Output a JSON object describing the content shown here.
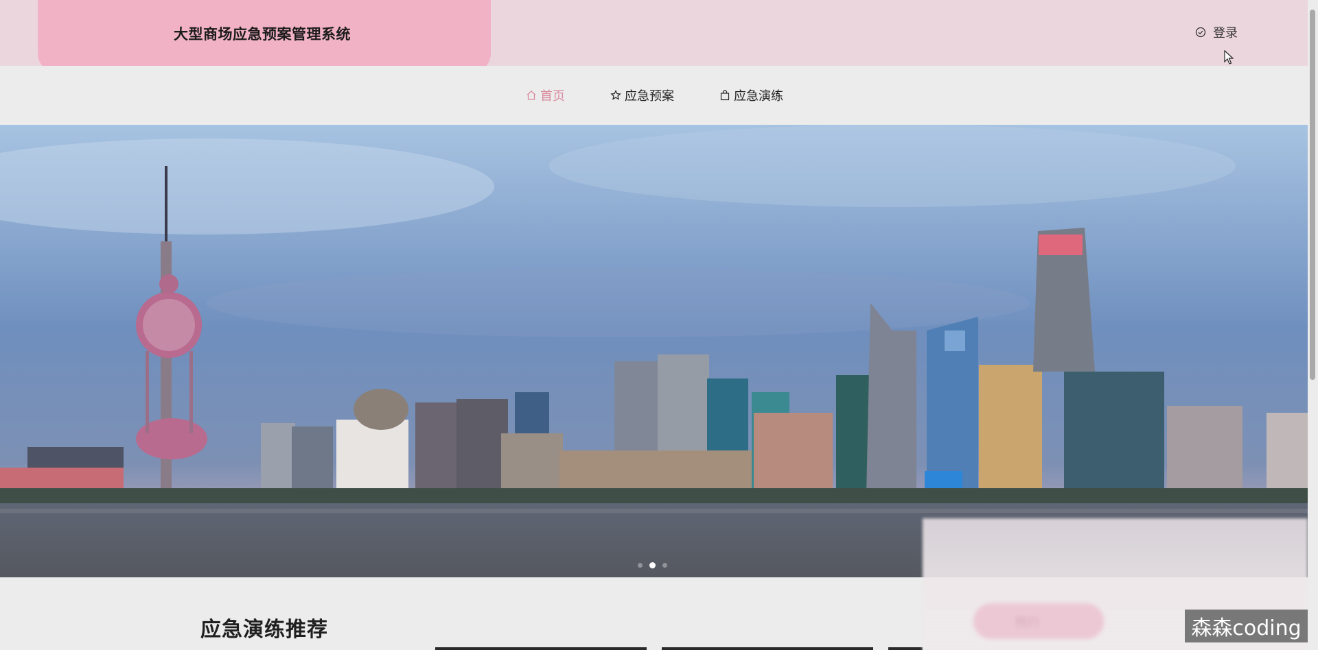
{
  "header": {
    "app_title": "大型商场应急预案管理系统",
    "login_label": "登录",
    "login_icon": "check-circle-icon"
  },
  "nav": {
    "items": [
      {
        "label": "首页",
        "icon": "home-icon",
        "active": true
      },
      {
        "label": "应急预案",
        "icon": "star-icon",
        "active": false
      },
      {
        "label": "应急演练",
        "icon": "bag-icon",
        "active": false
      }
    ]
  },
  "banner": {
    "image": "city-skyline-photo",
    "slides": 3,
    "active_slide": 2
  },
  "section": {
    "title": "应急演练推荐"
  },
  "float_panel": {
    "pill_label": "预约"
  },
  "watermark": "森森coding",
  "colors": {
    "header_bg": "#ecd6de",
    "brand_bg": "#f1b2c6",
    "nav_active": "#d98a9f",
    "page_bg": "#ececec"
  }
}
